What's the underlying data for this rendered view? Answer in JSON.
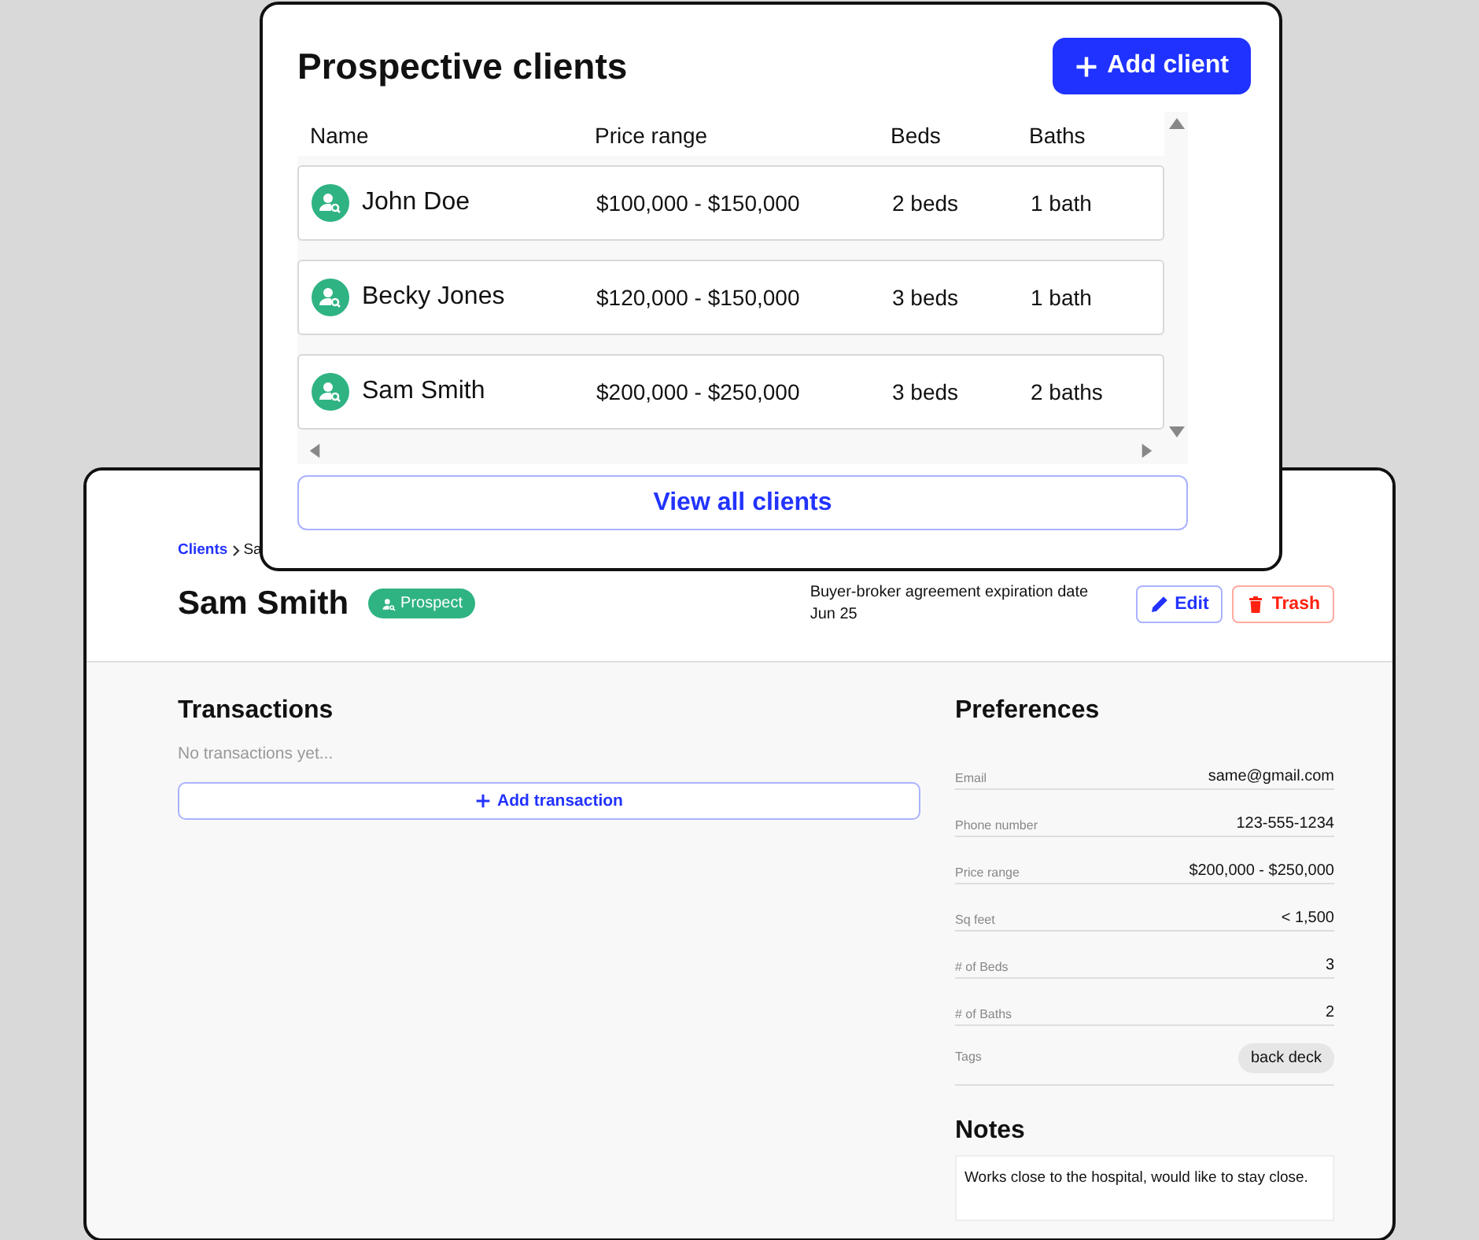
{
  "client_detail": {
    "breadcrumb": [
      {
        "label": "Clients"
      },
      {
        "label": "Sa"
      }
    ],
    "name": "Sam Smith",
    "status_badge": "Prospect",
    "agreement": {
      "label": "Buyer-broker agreement expiration date",
      "value": "Jun 25"
    },
    "buttons": [
      {
        "kind": "edit",
        "label": "Edit"
      },
      {
        "kind": "trash",
        "label": "Trash"
      }
    ],
    "transactions": {
      "title": "Transactions",
      "empty_text": "No transactions yet...",
      "add_button": "Add transaction"
    },
    "preferences": {
      "title": "Preferences",
      "fields": [
        {
          "label": "Email",
          "value": "same@gmail.com"
        },
        {
          "label": "Phone number",
          "value": "123-555-1234"
        },
        {
          "label": "Price range",
          "value": "$200,000 - $250,000"
        },
        {
          "label": "Sq feet",
          "value": "< 1,500"
        },
        {
          "label": "# of Beds",
          "value": "3"
        },
        {
          "label": "# of Baths",
          "value": "2"
        }
      ],
      "tags": {
        "label": "Tags",
        "items": [
          "back deck"
        ]
      }
    },
    "notes": {
      "title": "Notes",
      "text": "Works close to the hospital, would like to stay close."
    }
  },
  "clients_panel": {
    "title": "Prospective clients",
    "add_button": "Add client",
    "columns": [
      "Name",
      "Price range",
      "Beds",
      "Baths"
    ],
    "rows": [
      {
        "name": "John Doe",
        "price_range": "$100,000 - $150,000",
        "beds": "2 beds",
        "baths": "1 bath"
      },
      {
        "name": "Becky Jones",
        "price_range": "$120,000 - $150,000",
        "beds": "3 beds",
        "baths": "1 bath"
      },
      {
        "name": "Sam Smith",
        "price_range": "$200,000 - $250,000",
        "beds": "3 beds",
        "baths": "2 baths"
      }
    ],
    "view_all_button": "View all clients"
  }
}
